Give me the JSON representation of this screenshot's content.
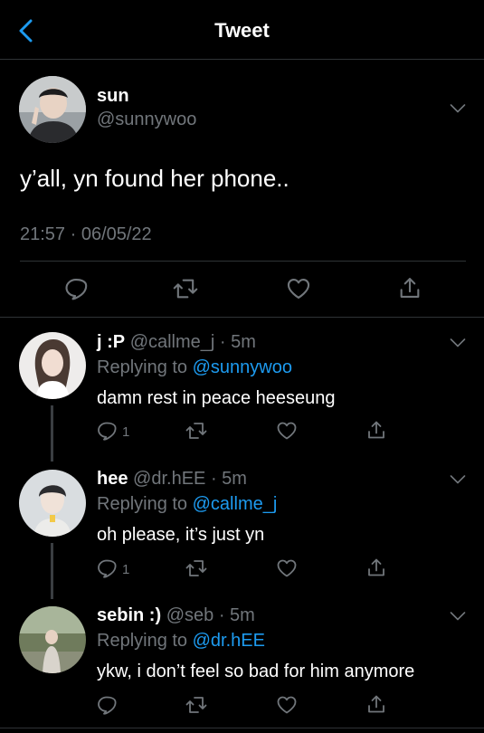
{
  "header": {
    "title": "Tweet"
  },
  "tweet": {
    "name": "sun",
    "handle": "@sunnywoo",
    "text": "y’all, yn found her phone..",
    "timestamp": "21:57 · 06/05/22"
  },
  "replies": [
    {
      "name": "j :P",
      "handle": "@callme_j",
      "time": "· 5m",
      "replying_prefix": "Replying to",
      "replying_to": "@sunnywoo",
      "text": "damn rest in peace heeseung",
      "reply_count": "1"
    },
    {
      "name": "hee",
      "handle": "@dr.hEE",
      "time": "· 5m",
      "replying_prefix": "Replying to",
      "replying_to": "@callme_j",
      "text": "oh please, it’s just yn",
      "reply_count": "1"
    },
    {
      "name": "sebin :)",
      "handle": "@seb",
      "time": "· 5m",
      "replying_prefix": "Replying to",
      "replying_to": "@dr.hEE",
      "text": "ykw, i don’t feel so bad for him anymore",
      "reply_count": ""
    }
  ],
  "icons": [
    "back-icon",
    "chevron-down-icon",
    "reply-icon",
    "retweet-icon",
    "like-icon",
    "share-icon"
  ],
  "colors": {
    "background": "#000000",
    "accent": "#1d9bf0",
    "secondary_text": "#71767b",
    "divider": "#2f3336"
  }
}
